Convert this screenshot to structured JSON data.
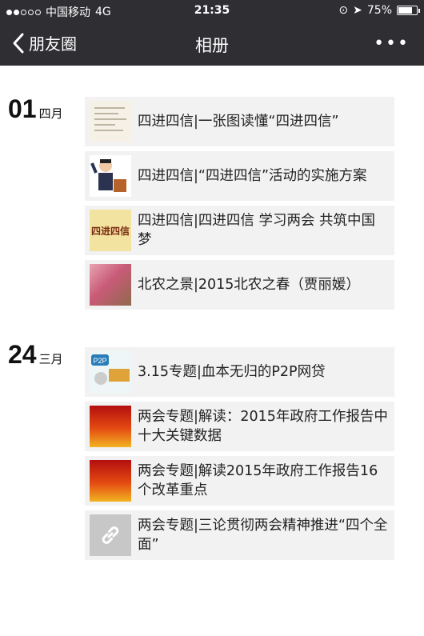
{
  "status_bar": {
    "carrier": "中国移动",
    "network": "4G",
    "time": "21:35",
    "battery": "75%",
    "battery_level": 0.75
  },
  "nav": {
    "back_label": "朋友圈",
    "title": "相册",
    "more_label": "•••"
  },
  "groups": [
    {
      "day": "01",
      "month": "四月",
      "items": [
        {
          "title": "四进四信|一张图读懂“四进四信”",
          "thumb": "document-thumbnail"
        },
        {
          "title": "四进四信|“四进四信”活动的实施方案",
          "thumb": "cartoon-speaker-thumbnail"
        },
        {
          "title": "四进四信|四进四信 学习两会 共筑中国梦",
          "thumb": "banner-thumbnail",
          "thumb_text": "四进四信"
        },
        {
          "title": "北农之景|2015北农之春（贾丽媛）",
          "thumb": "flower-photo-thumbnail"
        }
      ]
    },
    {
      "day": "24",
      "month": "三月",
      "items": [
        {
          "title": "3.15专题|血本无归的P2P网贷",
          "thumb": "p2p-thumbnail",
          "thumb_text": "P2P"
        },
        {
          "title": "两会专题|解读：2015年政府工作报告中十大关键数据",
          "thumb": "red-banner-thumbnail"
        },
        {
          "title": "两会专题|解读2015年政府工作报告16个改革重点",
          "thumb": "red-banner-thumbnail"
        },
        {
          "title": "两会专题|三论贯彻两会精神推进“四个全面”",
          "thumb": "link-icon"
        }
      ]
    }
  ]
}
